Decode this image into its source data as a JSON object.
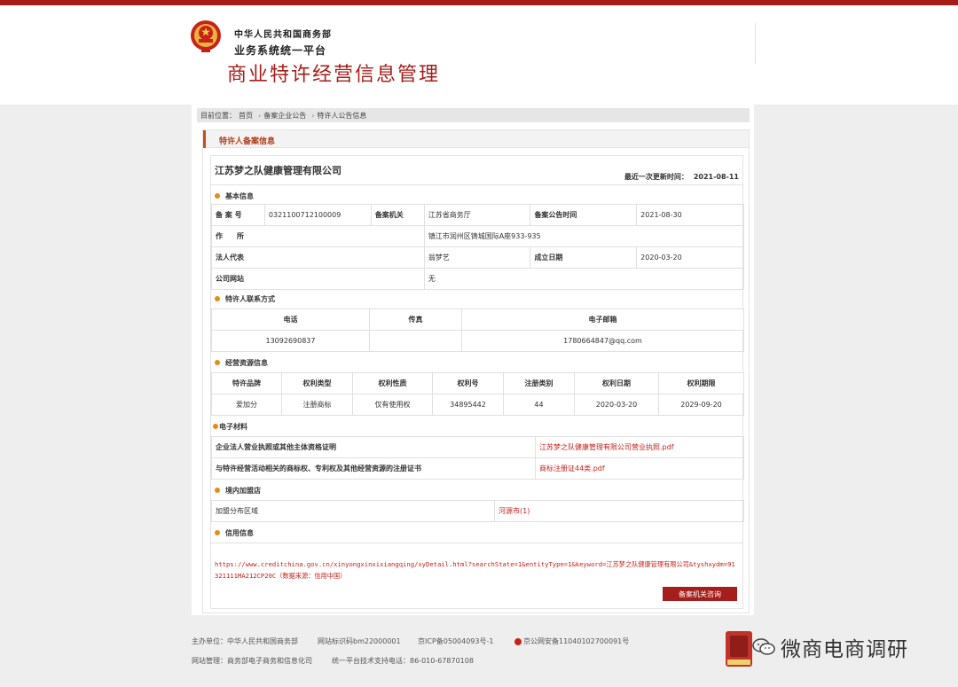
{
  "header": {
    "gov_name": "中华人民共和国商务部",
    "platform_name": "业务系统统一平台",
    "system_name": "商业特许经营信息管理"
  },
  "breadcrumb": {
    "prefix": "目前位置：",
    "items": [
      "首页",
      "备案企业公告",
      "特许人公告信息"
    ]
  },
  "panel_title": "特许人备案信息",
  "company": {
    "name": "江苏梦之队健康管理有限公司",
    "updated_label": "最近一次更新时间：",
    "updated_value": "2021-08-11"
  },
  "basic": {
    "title": "基本信息",
    "record_no_label": "备 案 号",
    "record_no": "0321100712100009",
    "authority_label": "备案机关",
    "authority": "江苏省商务厅",
    "announce_label": "备案公告时间",
    "announce": "2021-08-30",
    "address_label": "作　　所",
    "address": "镇江市润州区铸城国际A座933-935",
    "legal_label": "法人代表",
    "legal": "翁梦艺",
    "founded_label": "成立日期",
    "founded": "2020-03-20",
    "website_label": "公司网站",
    "website": "无"
  },
  "contact": {
    "title": "特许人联系方式",
    "headers": [
      "电话",
      "传真",
      "电子邮箱"
    ],
    "phone": "13092690837",
    "fax": "",
    "email": "1780664847@qq.com"
  },
  "resources": {
    "title": "经营资源信息",
    "headers": [
      "特许品牌",
      "权利类型",
      "权利性质",
      "权利号",
      "注册类别",
      "权利日期",
      "权利期限"
    ],
    "row": [
      "爱加分",
      "注册商标",
      "仅有使用权",
      "34895442",
      "44",
      "2020-03-20",
      "2029-09-20"
    ]
  },
  "materials": {
    "title": "电子材料",
    "items": [
      {
        "label": "企业法人营业执照或其他主体资格证明",
        "file": "江苏梦之队健康管理有限公司营业执照.pdf"
      },
      {
        "label": "与特许经营活动相关的商标权、专利权及其他经营资源的注册证书",
        "file": "商标注册证44类.pdf"
      }
    ]
  },
  "stores": {
    "title": "境内加盟店",
    "label": "加盟分布区域",
    "value": "河源市(1)"
  },
  "credit": {
    "title": "信用信息",
    "url": "https://www.creditchina.gov.cn/xinyongxinxixiangqing/xyDetail.html?searchState=1&entityType=1&keyword=江苏梦之队健康管理有限公司&tyshxydm=91321111MA212CP20C（数据来源：信用中国）",
    "button": "备案机关咨询"
  },
  "footer": {
    "host": "主办单位：中华人民共和国商务部",
    "icp_code": "网站标识码bm22000001",
    "icp": "京ICP备05004093号-1",
    "police": "京公网安备11040102700091号",
    "manage": "网站管理：商务部电子商务和信息化司",
    "support": "统一平台技术支持电话：86-010-67870108"
  },
  "brand": {
    "wechat_name": "微商电商调研"
  },
  "colors": {
    "accent": "#a61e1a",
    "link_red": "#c8211b",
    "dot_orange": "#e88a1a"
  }
}
